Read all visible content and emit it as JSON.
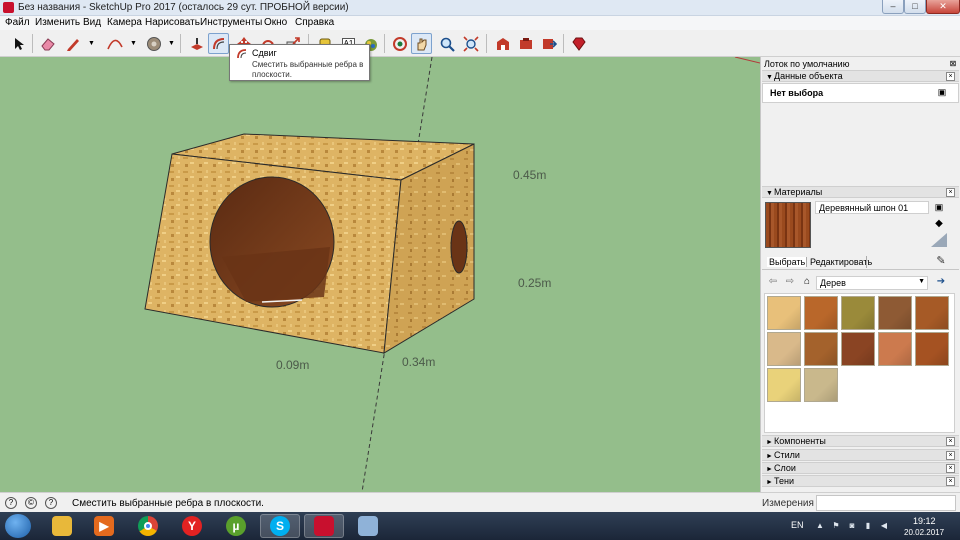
{
  "window": {
    "title": "Без названия - SketchUp Pro 2017 (осталось 29 сут. ПРОБНОЙ версии)",
    "controls": {
      "minimize": "‒",
      "maximize": "□",
      "close": "✕"
    }
  },
  "menu": [
    "Файл",
    "Изменить",
    "Вид",
    "Камера",
    "Нарисовать",
    "Инструменты",
    "Окно",
    "Справка"
  ],
  "toolbar": {
    "tools": [
      "select-icon",
      "eraser-icon",
      "pencil-icon",
      "arc-icon",
      "paint-bucket-icon",
      "push-pull-icon",
      "offset-icon",
      "move-icon",
      "rotate-icon",
      "scale-icon",
      "tape-measure-icon",
      "text-icon",
      "paint-icon",
      "orbit-icon",
      "pan-icon",
      "zoom-icon",
      "zoom-extents-icon",
      "warehouse-icon",
      "extension-icon",
      "send-icon",
      "ruby-icon"
    ],
    "text_tool_label": "A1"
  },
  "tooltip": {
    "title": "Сдвиг",
    "description": "Сместить выбранные ребра в плоскости."
  },
  "viewport": {
    "dimensions": {
      "height_top": "0.45m",
      "height_side": "0.25m",
      "width_front": "0.09m",
      "depth": "0.34m"
    },
    "colors": {
      "background": "#94be8b",
      "wood": "#deb464"
    }
  },
  "tray": {
    "title": "Лоток по умолчанию",
    "entity_info": {
      "header": "Данные объекта",
      "value": "Нет выбора"
    },
    "materials": {
      "header": "Материалы",
      "current_name": "Деревянный шпон 01",
      "tabs": [
        "Выбрать",
        "Редактировать"
      ],
      "library": "Дерев",
      "swatches": [
        "#e8c07a",
        "#b9672a",
        "#9a8a3a",
        "#8e5a34",
        "#a65a26",
        "#d9b98a",
        "#a4622c",
        "#8a4423",
        "#cc7a4e",
        "#a55222",
        "#e9d27a",
        "#c9b88c"
      ]
    },
    "collapsed_panels": [
      "Компоненты",
      "Стили",
      "Слои",
      "Тени"
    ]
  },
  "statusbar": {
    "hint": "Сместить выбранные ребра в плоскости.",
    "measurements_label": "Измерения",
    "measurements_value": ""
  },
  "taskbar": {
    "apps": [
      "explorer",
      "media-player",
      "chrome",
      "yandex",
      "utorrent",
      "skype",
      "sketchup",
      "paint"
    ],
    "language": "EN",
    "time": "19:12",
    "date": "20.02.2017"
  }
}
